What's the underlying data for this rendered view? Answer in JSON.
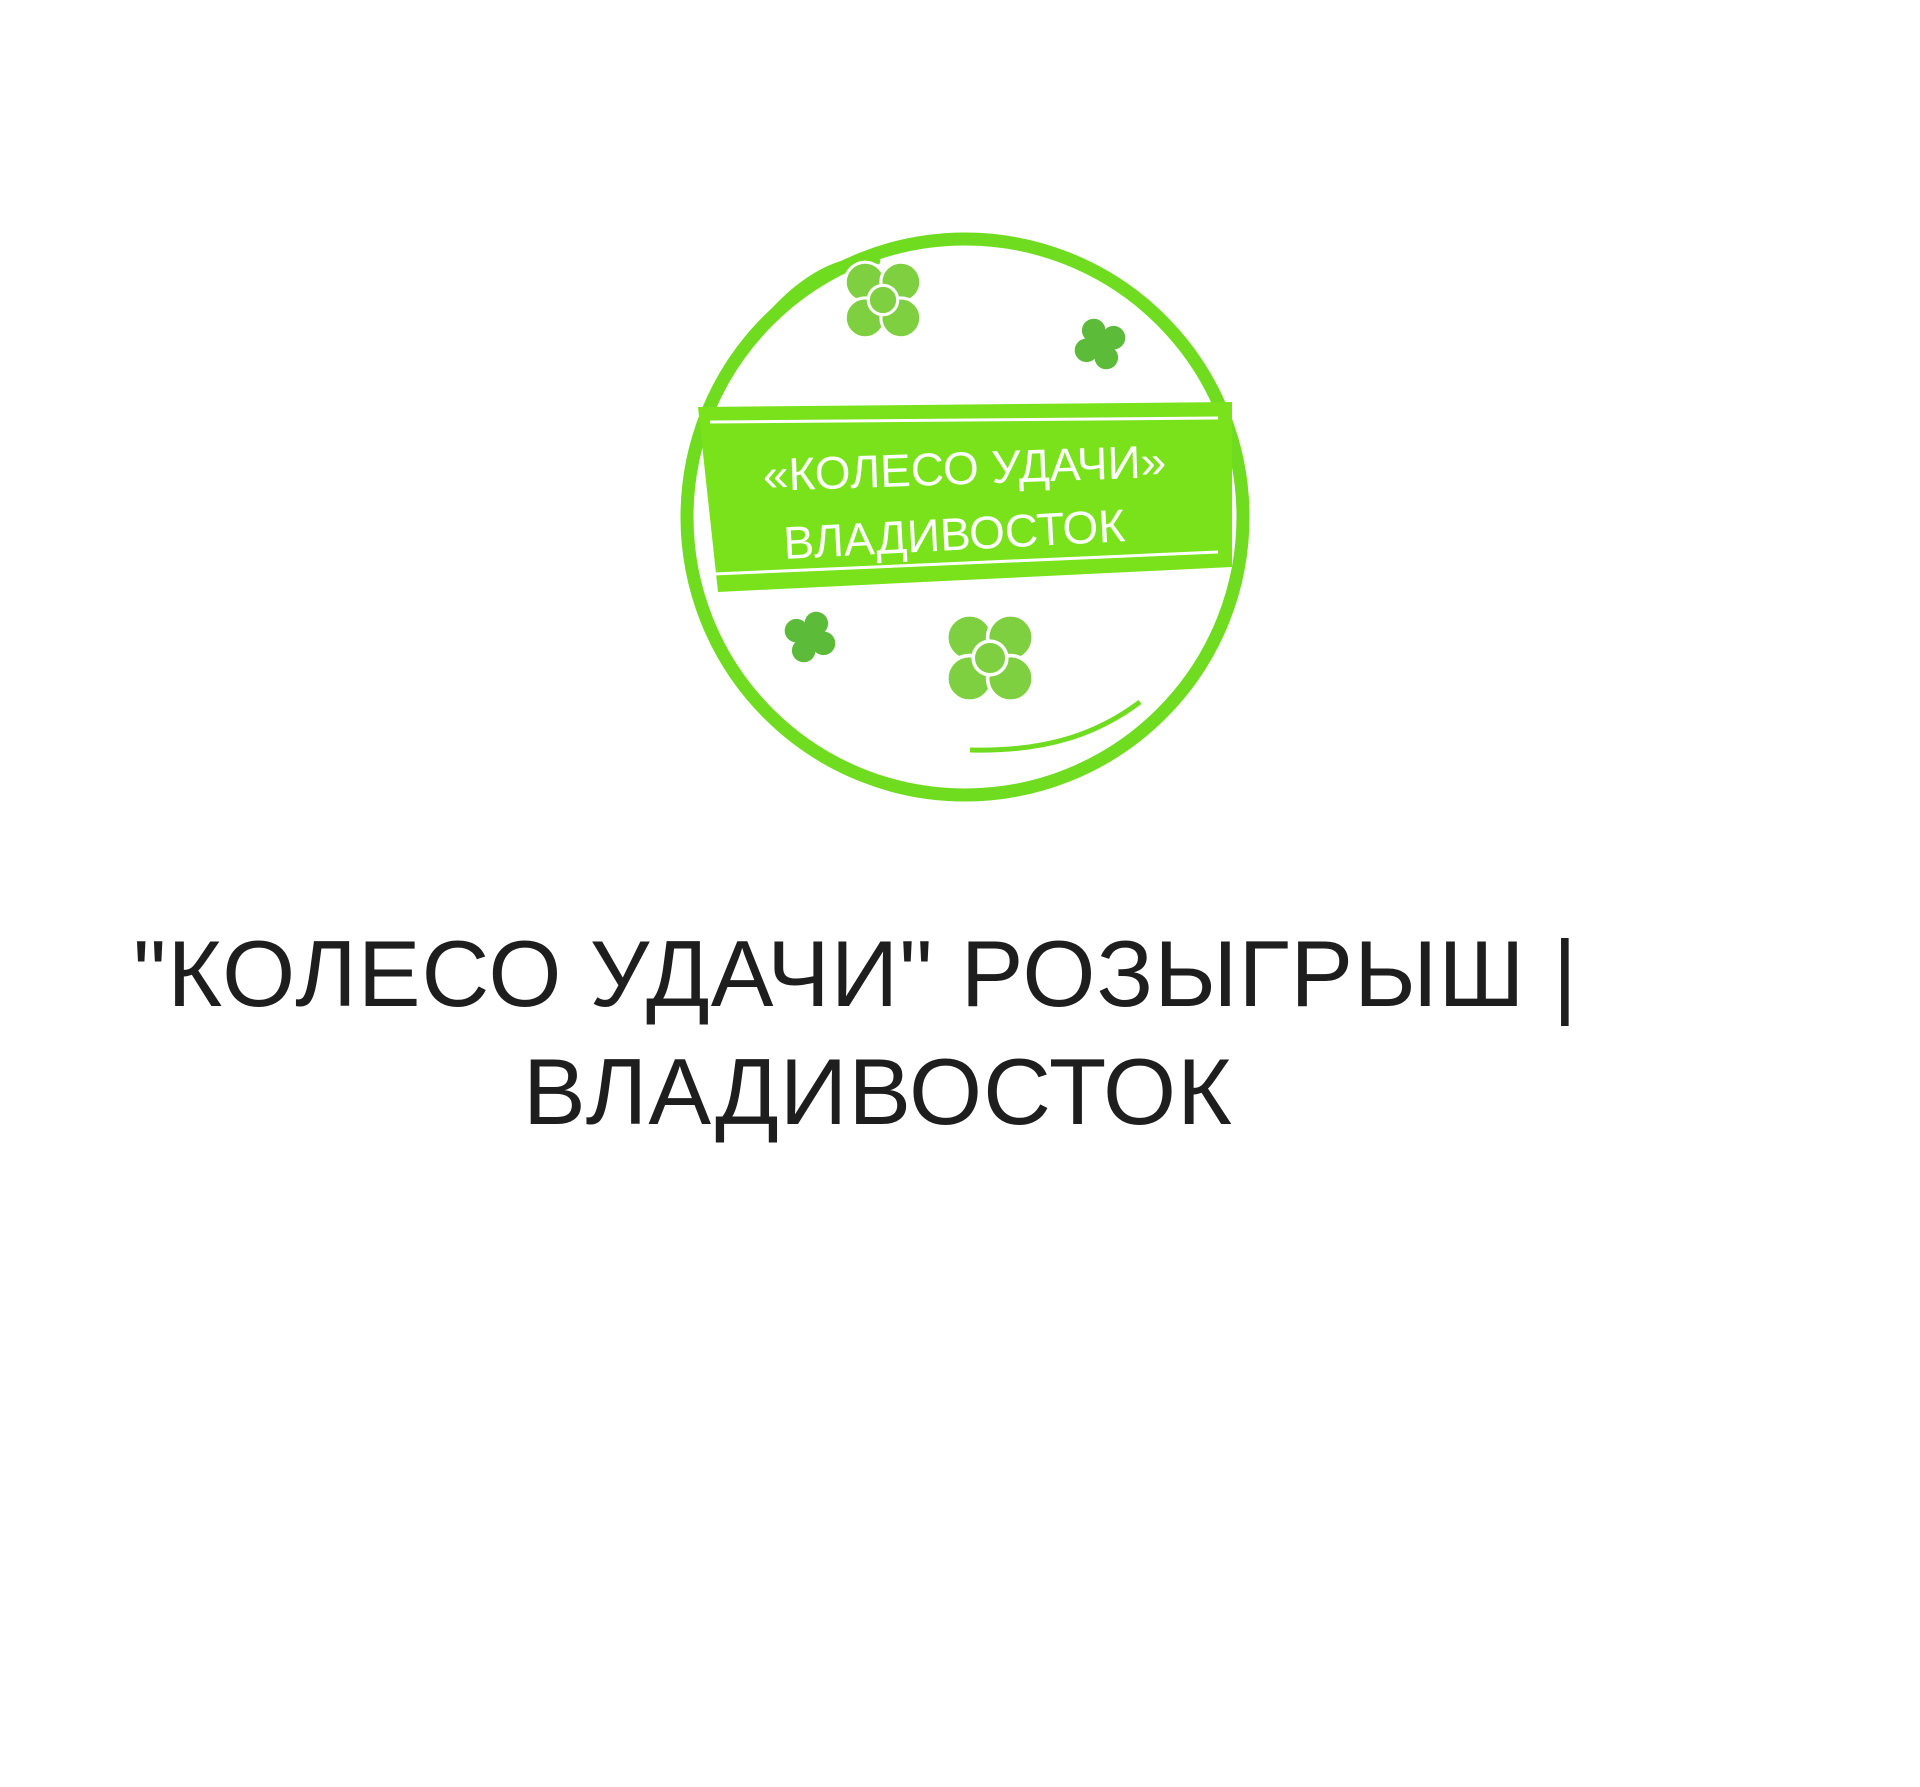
{
  "logo": {
    "line1": "«КОЛЕСО УДАЧИ»",
    "line2": "ВЛАДИВОСТОК",
    "colors": {
      "ring": "#6fdc1f",
      "band": "#7ae21a",
      "clover_dark": "#5dbb3a",
      "clover_light": "#7fd040",
      "text": "#ffffff"
    },
    "icons": [
      "clover-icon",
      "clover-icon",
      "clover-icon",
      "clover-icon"
    ]
  },
  "page": {
    "title_line1": "\"КОЛЕСО УДАЧИ\" РОЗЫГРЫШ |",
    "title_line2": "ВЛАДИВОСТОК"
  }
}
